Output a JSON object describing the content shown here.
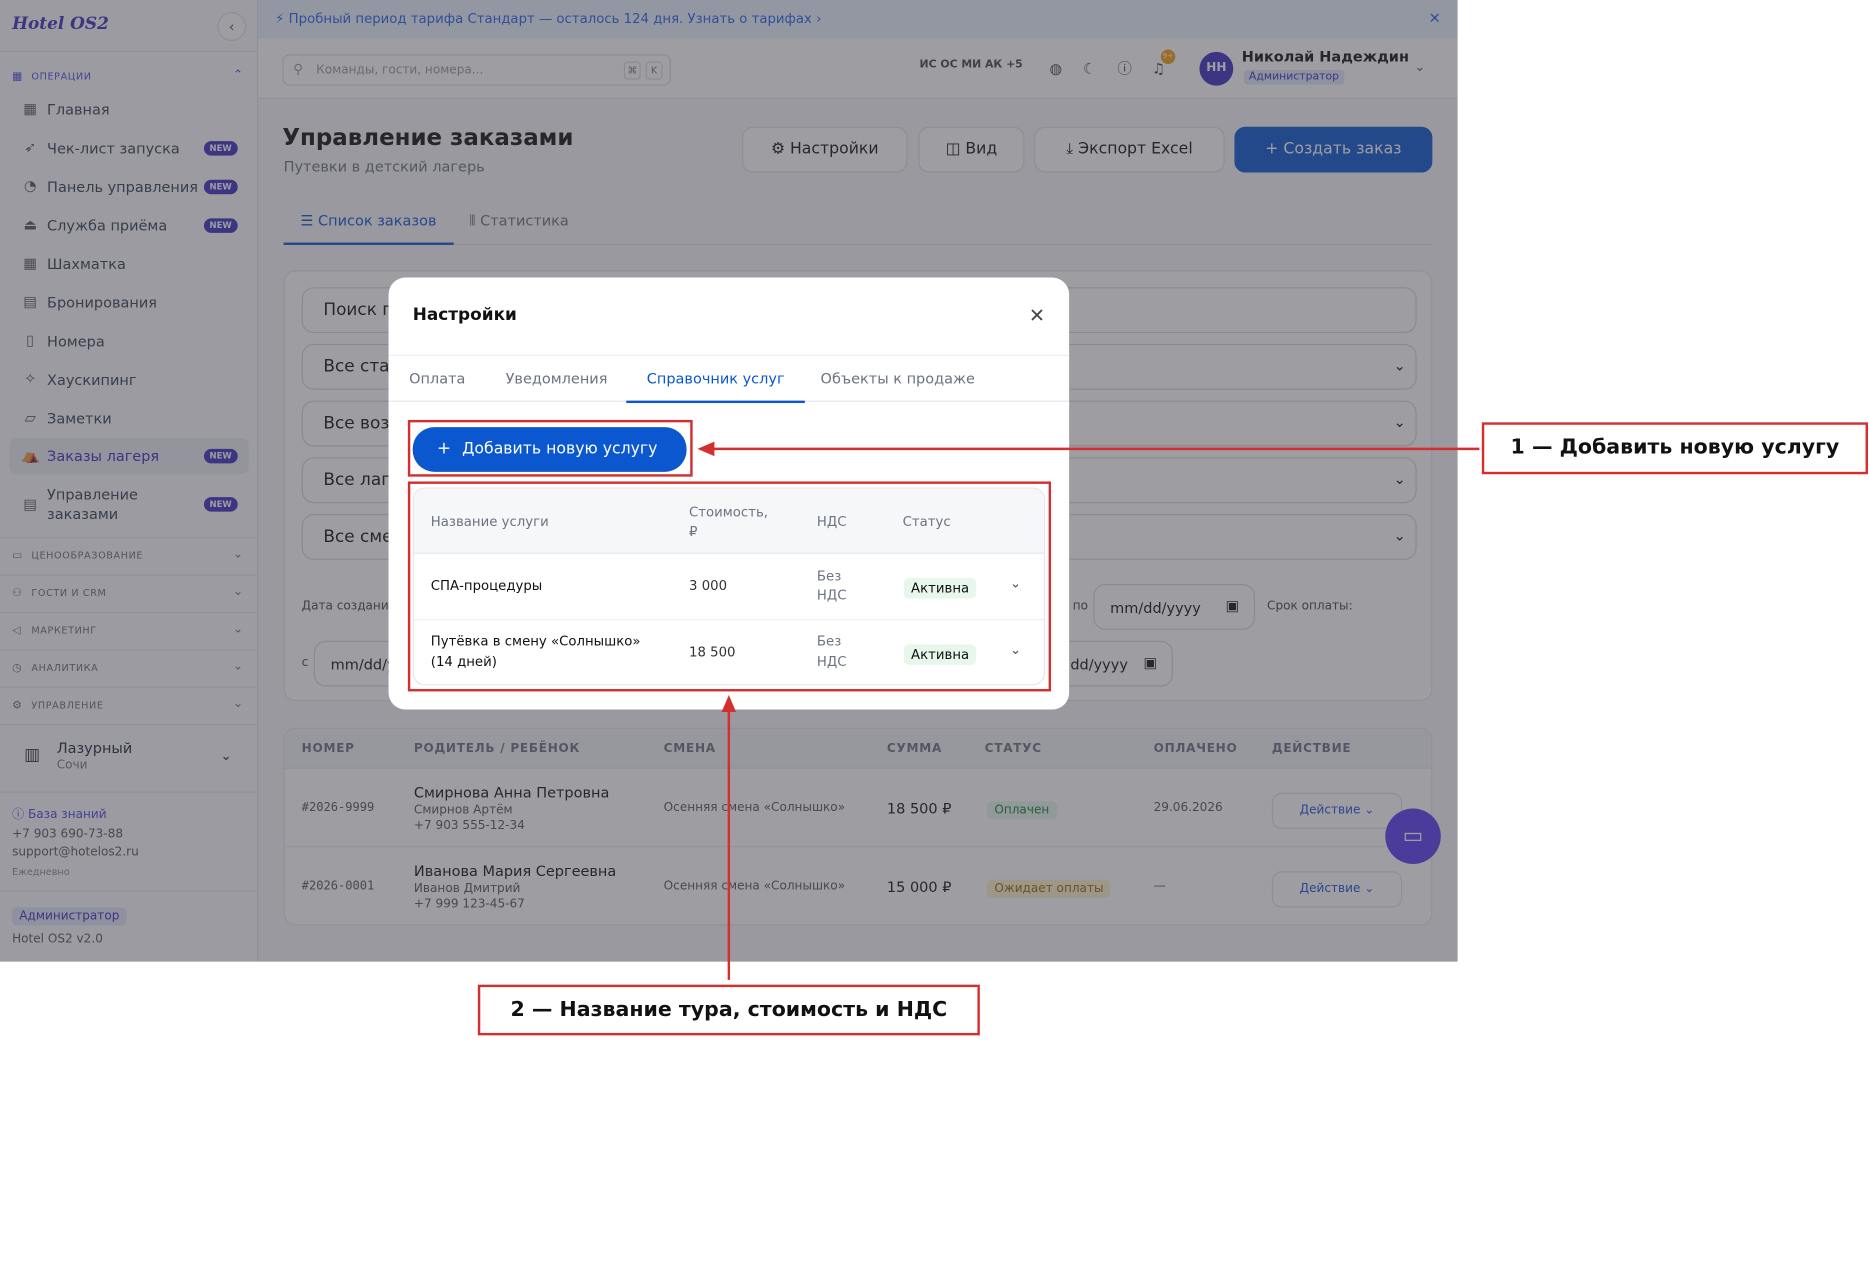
{
  "app": {
    "logo": "Hotel OS2",
    "version": "Hotel OS2 v2.0"
  },
  "banner": {
    "text": "Пробный период тарифа Стандарт — осталось 124 дня.",
    "link": "Узнать о тарифах ›"
  },
  "search": {
    "placeholder": "Команды, гости, номера...",
    "key1": "⌘",
    "key2": "K"
  },
  "topbar": {
    "avatars": "ИС ОС МИ АК +5",
    "bell_count": "9+",
    "user_initials": "НН",
    "user_name": "Николай Надеждин",
    "user_role": "Администратор"
  },
  "sidebar": {
    "section_ops": "ОПЕРАЦИИ",
    "items": [
      {
        "label": "Главная",
        "icon": "home-icon"
      },
      {
        "label": "Чек-лист запуска",
        "badge": "NEW",
        "icon": "rocket-icon"
      },
      {
        "label": "Панель управления",
        "badge": "NEW",
        "icon": "gauge-icon"
      },
      {
        "label": "Служба приёма",
        "badge": "NEW",
        "icon": "bell-service-icon"
      },
      {
        "label": "Шахматка",
        "icon": "grid-icon"
      },
      {
        "label": "Бронирования",
        "icon": "clipboard-icon"
      },
      {
        "label": "Номера",
        "icon": "door-icon"
      },
      {
        "label": "Хаускипинг",
        "icon": "sparkle-icon"
      },
      {
        "label": "Заметки",
        "icon": "note-icon"
      },
      {
        "label": "Заказы лагеря",
        "badge": "NEW",
        "icon": "tent-icon"
      },
      {
        "label": "Управление заказами",
        "badge": "NEW",
        "icon": "orders-icon"
      }
    ],
    "sections": [
      "ЦЕНООБРАЗОВАНИЕ",
      "ГОСТИ И CRM",
      "МАРКЕТИНГ",
      "АНАЛИТИКА",
      "УПРАВЛЕНИЕ"
    ],
    "hotel_name": "Лазурный",
    "hotel_city": "Сочи",
    "kb": "База знаний",
    "phone": "+7 903 690-73-88",
    "email": "support@hotelos2.ru",
    "hours": "Ежедневно",
    "role": "Администратор"
  },
  "page": {
    "title": "Управление заказами",
    "subtitle": "Путевки в детский лагерь",
    "btn_settings": "Настройки",
    "btn_view": "Вид",
    "btn_export": "Экспорт Excel",
    "btn_create": "Создать заказ",
    "tab_list": "Список заказов",
    "tab_stats": "Статистика"
  },
  "filters": {
    "search": "Поиск по",
    "status": "Все статусы",
    "age": "Все возрасты",
    "camp": "Все лагеря",
    "shift": "Все смены",
    "created": "Дата создания",
    "to": "по",
    "from": "с",
    "date_ph": "mm/dd/yyyy",
    "due": "Срок оплаты:",
    "date_ph_short": "dd/yyyy"
  },
  "orders": {
    "headers": [
      "НОМЕР",
      "РОДИТЕЛЬ / РЕБЁНОК",
      "СМЕНА",
      "СУММА",
      "СТАТУС",
      "ОПЛАЧЕНО",
      "ДЕЙСТВИЕ"
    ],
    "rows": [
      {
        "num": "#2026-9999",
        "parent": "Смирнова Анна Петровна",
        "child": "Смирнов Артём",
        "phone": "+7 903 555-12-34",
        "shift": "Осенняя смена «Солнышко»",
        "sum": "18 500 ₽",
        "status": "Оплачен",
        "paid": "29.06.2026",
        "action": "Действие"
      },
      {
        "num": "#2026-0001",
        "parent": "Иванова Мария Сергеевна",
        "child": "Иванов Дмитрий",
        "phone": "+7 999 123-45-67",
        "shift": "Осенняя смена «Солнышко»",
        "sum": "15 000 ₽",
        "status": "Ожидает оплаты",
        "paid": "—",
        "action": "Действие"
      }
    ]
  },
  "modal": {
    "title": "Настройки",
    "tabs": [
      "Оплата",
      "Уведомления",
      "Справочник услуг",
      "Объекты к продаже"
    ],
    "add_button": "Добавить новую услугу",
    "headers": {
      "name": "Название услуги",
      "cost1": "Стоимость,",
      "cost2": "₽",
      "vat": "НДС",
      "status": "Статус"
    },
    "services": [
      {
        "name1": "СПА-процедуры",
        "name2": "",
        "cost": "3 000",
        "vat1": "Без",
        "vat2": "НДС",
        "status": "Активна"
      },
      {
        "name1": "Путёвка в смену «Солнышко»",
        "name2": "(14 дней)",
        "cost": "18 500",
        "vat1": "Без",
        "vat2": "НДС",
        "status": "Активна"
      }
    ]
  },
  "annotations": {
    "label1": "1 — Добавить новую услугу",
    "label2": "2 — Название тура, стоимость и НДС",
    "color": "#d32f2f"
  }
}
